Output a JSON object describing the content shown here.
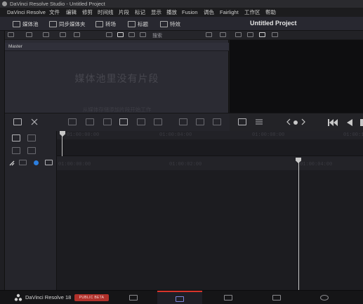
{
  "window": {
    "title": "DaVinci Resolve Studio - Untitled Project"
  },
  "menu": {
    "items": [
      "DaVinci Resolve",
      "文件",
      "编辑",
      "修剪",
      "时间线",
      "片段",
      "标记",
      "显示",
      "播放",
      "Fusion",
      "调色",
      "Fairlight",
      "工作区",
      "帮助"
    ]
  },
  "toolbar": {
    "media_pool": "媒体池",
    "sync_bin": "同步媒体夹",
    "transitions": "转场",
    "titles": "标题",
    "effects": "特效",
    "project_title": "Untitled Project"
  },
  "media_pool": {
    "bin_name": "Master",
    "empty_title": "媒体池里没有片段",
    "empty_subtitle": "从媒体存储添加片段开始工作"
  },
  "subtoolbar": {
    "search_label": "搜索"
  },
  "timeline": {
    "ruler_top": [
      "01:00:00:00",
      "01:00:04:00",
      "01:00:08:00",
      "01:00:12:00"
    ],
    "ruler_bottom": [
      "01:00:00:00",
      "01:00:02:00",
      "01:00:04:00"
    ]
  },
  "bottombar": {
    "brand": "DaVinci Resolve 18",
    "badge": "PUBLIC BETA"
  },
  "colors": {
    "accent": "#d8342b",
    "badge": "#b0302a",
    "background": "#1a1a1c"
  }
}
